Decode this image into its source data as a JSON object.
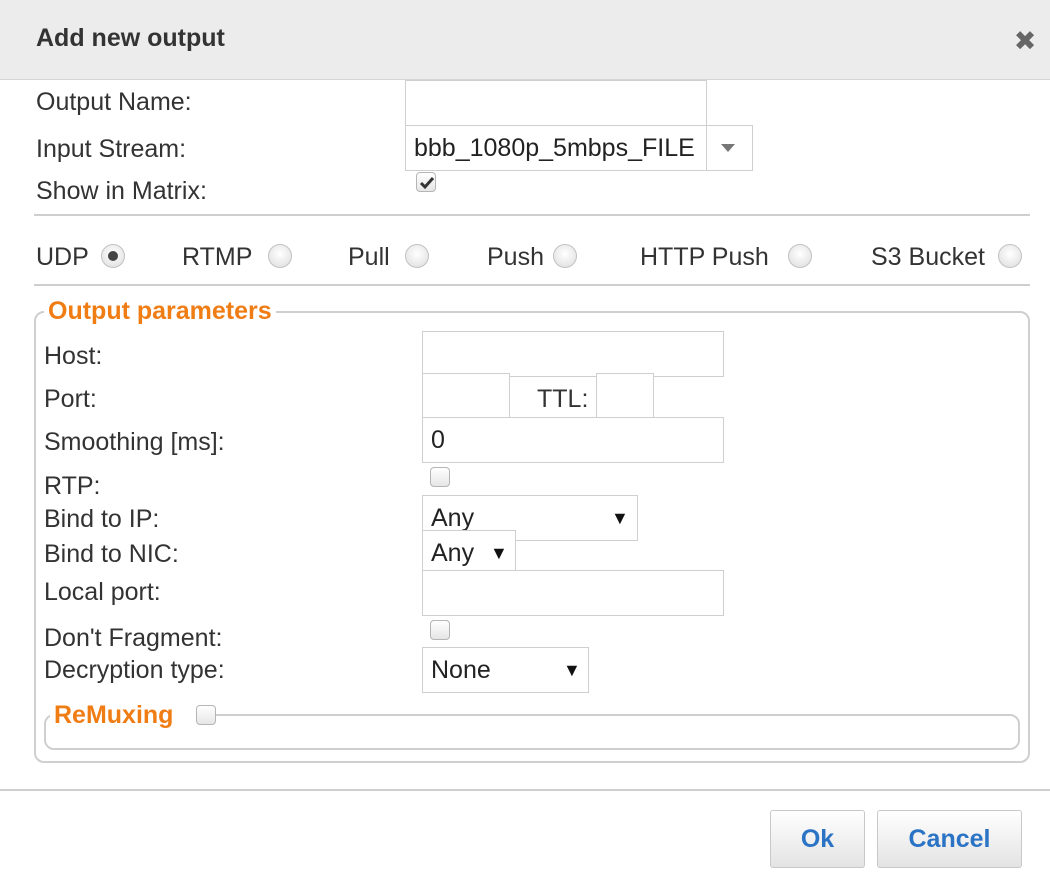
{
  "dialog": {
    "title": "Add new output",
    "close_icon": "close-icon"
  },
  "general": {
    "output_name_label": "Output Name:",
    "output_name_value": "",
    "input_stream_label": "Input Stream:",
    "input_stream_value": "bbb_1080p_5mbps_FILE",
    "show_in_matrix_label": "Show in Matrix:",
    "show_in_matrix_checked": true
  },
  "output_types": [
    {
      "label": "UDP",
      "selected": true
    },
    {
      "label": "RTMP",
      "selected": false
    },
    {
      "label": "Pull",
      "selected": false
    },
    {
      "label": "Push",
      "selected": false
    },
    {
      "label": "HTTP Push",
      "selected": false
    },
    {
      "label": "S3 Bucket",
      "selected": false
    }
  ],
  "output_parameters": {
    "legend": "Output parameters",
    "host_label": "Host:",
    "host_value": "",
    "port_label": "Port:",
    "port_value": "",
    "ttl_label": "TTL:",
    "ttl_value": "",
    "smoothing_label": "Smoothing [ms]:",
    "smoothing_value": "0",
    "rtp_label": "RTP:",
    "rtp_checked": false,
    "bind_ip_label": "Bind to IP:",
    "bind_ip_value": "Any",
    "bind_nic_label": "Bind to NIC:",
    "bind_nic_value": "Any",
    "local_port_label": "Local port:",
    "local_port_value": "",
    "dont_fragment_label": "Don't Fragment:",
    "dont_fragment_checked": false,
    "decryption_label": "Decryption type:",
    "decryption_value": "None"
  },
  "remuxing": {
    "legend": "ReMuxing",
    "checked": false
  },
  "buttons": {
    "ok": "Ok",
    "cancel": "Cancel"
  },
  "colors": {
    "accent_orange": "#f07c14",
    "button_text_blue": "#2a73c5",
    "titlebar_bg": "#ececec"
  }
}
